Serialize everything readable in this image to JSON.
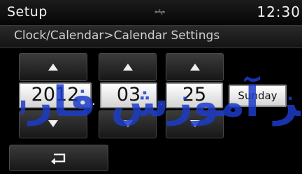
{
  "header": {
    "title": "Setup",
    "clock": "12:30",
    "usb_icon": "usb-icon"
  },
  "breadcrumb": "Clock/Calendar>Calendar Settings",
  "date": {
    "year": "2012",
    "month": "03",
    "day": "25",
    "separator": "."
  },
  "weekday": "Sunday",
  "watermark_text": "مرکز آموزش فارسی",
  "icons": {
    "up": "arrow-up-icon",
    "down": "arrow-down-icon",
    "back": "back-icon"
  },
  "colors": {
    "background": "#000000",
    "field": "#ffffff",
    "watermark": "#1c3cc8"
  }
}
